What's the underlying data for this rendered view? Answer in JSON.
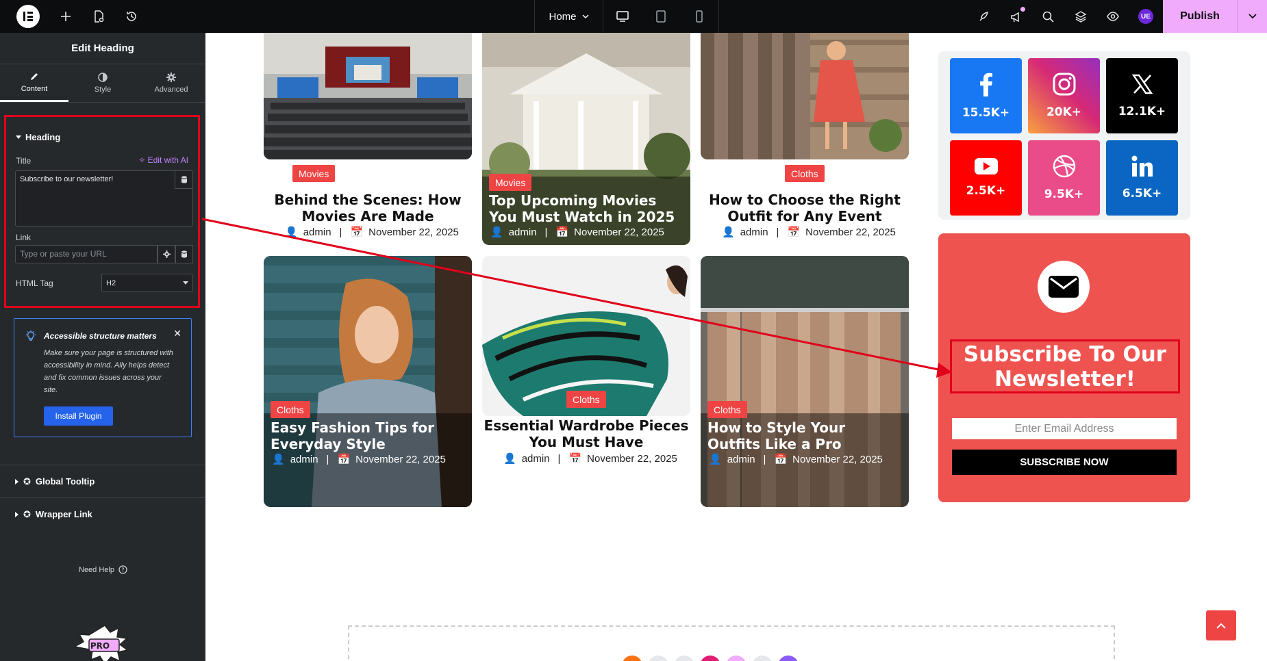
{
  "topbar": {
    "page_select": "Home",
    "publish_label": "Publish",
    "user_initials": "UE",
    "colors": {
      "bg": "#0c0d0e",
      "publish": "#f0abfc"
    }
  },
  "sidebar": {
    "title": "Edit Heading",
    "tabs": [
      {
        "label": "Content",
        "icon": "pencil-icon",
        "active": true
      },
      {
        "label": "Style",
        "icon": "contrast-icon",
        "active": false
      },
      {
        "label": "Advanced",
        "icon": "gear-icon",
        "active": false
      }
    ],
    "section_label": "Heading",
    "title_label": "Title",
    "edit_ai_label": "Edit with AI",
    "title_value": "Subscribe to our newsletter!",
    "link_label": "Link",
    "link_placeholder": "Type or paste your URL",
    "html_tag_label": "HTML Tag",
    "html_tag_value": "H2",
    "notice": {
      "title": "Accessible structure matters",
      "body": "Make sure your page is structured with accessibility in mind. Ally helps detect and fix common issues across your site.",
      "button": "Install Plugin"
    },
    "global_tooltip": "Global Tooltip",
    "wrapper_link": "Wrapper Link",
    "need_help": "Need Help"
  },
  "posts": [
    {
      "tag": "Movies",
      "title": "Behind the Scenes: How Movies Are Made",
      "author": "admin",
      "date": "November 22, 2025",
      "overlay": false
    },
    {
      "tag": "Movies",
      "title": "Top Upcoming Movies You Must Watch in 2025",
      "author": "admin",
      "date": "November 22, 2025",
      "overlay": true
    },
    {
      "tag": "Cloths",
      "title": "How to Choose the Right Outfit for Any Event",
      "author": "admin",
      "date": "November 22, 2025",
      "overlay": false
    },
    {
      "tag": "Cloths",
      "title": "Easy Fashion Tips for Everyday Style",
      "author": "admin",
      "date": "November 22, 2025",
      "overlay": true
    },
    {
      "tag": "Cloths",
      "title": "Essential Wardrobe Pieces You Must Have",
      "author": "admin",
      "date": "November 22, 2025",
      "overlay": false
    },
    {
      "tag": "Cloths",
      "title": "How to Style Your Outfits Like a Pro",
      "author": "admin",
      "date": "November 22, 2025",
      "overlay": true
    }
  ],
  "social": [
    {
      "network": "facebook",
      "icon": "facebook-icon",
      "count": "15.5K+",
      "color": "#1877f2"
    },
    {
      "network": "instagram",
      "icon": "instagram-icon",
      "count": "20K+",
      "color": "#d62976"
    },
    {
      "network": "x",
      "icon": "x-icon",
      "count": "12.1K+",
      "color": "#000000"
    },
    {
      "network": "youtube",
      "icon": "youtube-icon",
      "count": "2.5K+",
      "color": "#ff0000"
    },
    {
      "network": "dribbble",
      "icon": "dribbble-icon",
      "count": "9.5K+",
      "color": "#ea4c89"
    },
    {
      "network": "linkedin",
      "icon": "linkedin-icon",
      "count": "6.5K+",
      "color": "#0a66c2"
    }
  ],
  "newsletter": {
    "title": "Subscribe To Our Newsletter!",
    "email_placeholder": "Enter Email Address",
    "button": "SUBSCRIBE NOW",
    "bg_color": "#ef5350"
  },
  "accent_color": "#ef4444"
}
